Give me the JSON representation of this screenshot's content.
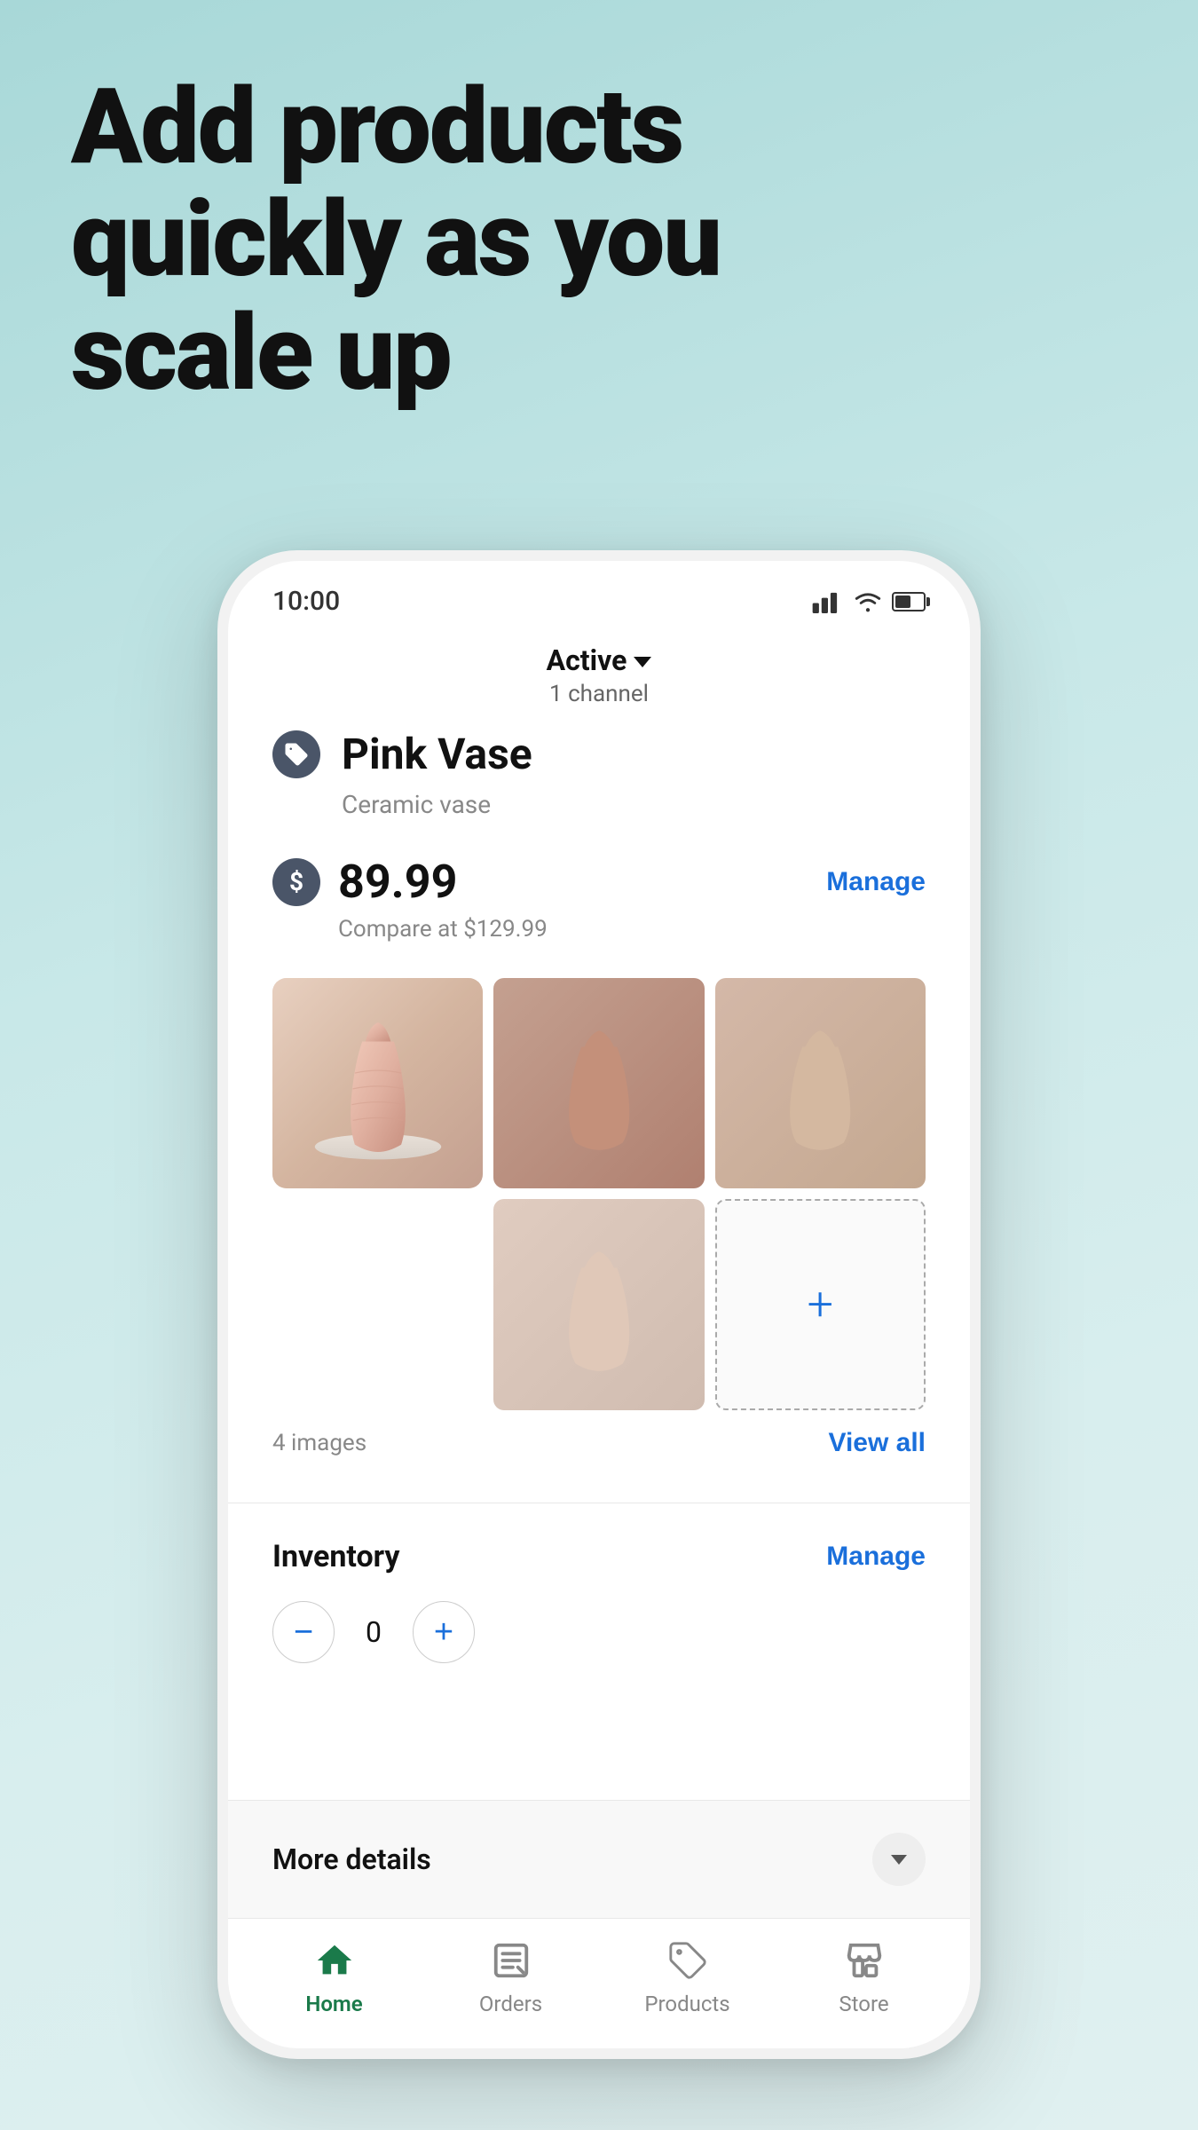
{
  "hero": {
    "title_line1": "Add products",
    "title_line2": "quickly as you",
    "title_line3": "scale up"
  },
  "status_bar": {
    "time": "10:00"
  },
  "product_header": {
    "status": "Active",
    "channel_count": "1 channel"
  },
  "product": {
    "name": "Pink Vase",
    "description": "Ceramic vase",
    "price": "89.99",
    "compare_at": "Compare at $129.99",
    "images_count": "4 images",
    "manage_price_label": "Manage",
    "view_all_label": "View all"
  },
  "inventory": {
    "label": "Inventory",
    "manage_label": "Manage",
    "value": "0",
    "decrement_label": "−",
    "increment_label": "+"
  },
  "more_details": {
    "label": "More details"
  },
  "bottom_nav": {
    "home_label": "Home",
    "orders_label": "Orders",
    "products_label": "Products",
    "store_label": "Store"
  },
  "active_channel_label": "Active channel"
}
